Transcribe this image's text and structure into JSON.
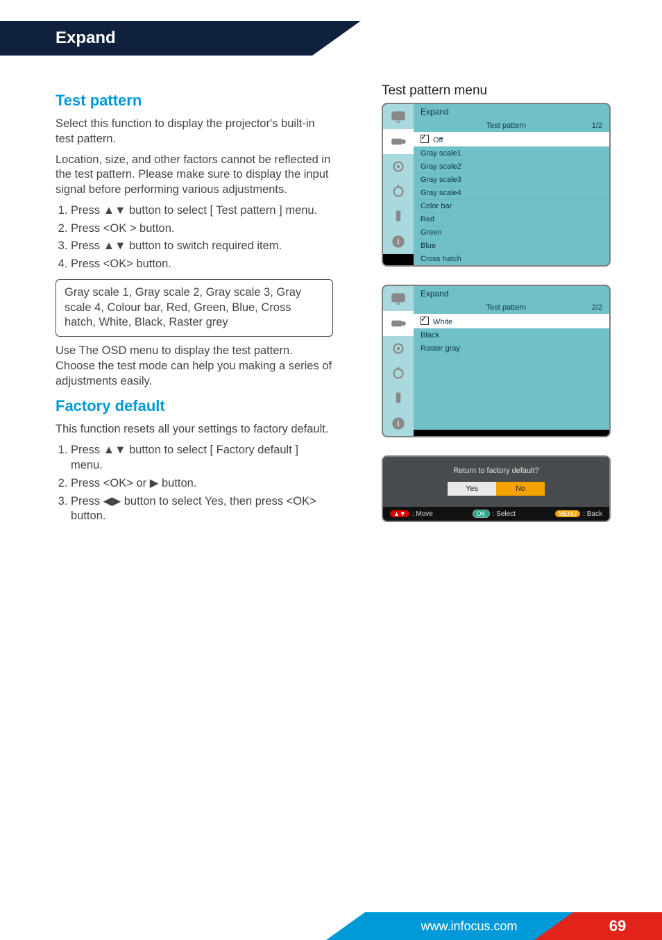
{
  "header": {
    "tab": "Expand"
  },
  "left": {
    "sec1_title": "Test pattern",
    "sec1_p1": "Select this function to display the projector's built-in test pattern.",
    "sec1_p2": "Location, size, and other factors cannot be reflected in the test pattern. Please make sure to display the input signal before performing various adjustments.",
    "sec1_steps": [
      "Press ▲▼ button to select [ Test pattern ] menu.",
      "Press <OK > button.",
      "Press ▲▼ button to switch required item.",
      "Press <OK> button."
    ],
    "sec1_box": "Gray scale 1, Gray scale 2, Gray scale 3, Gray scale 4, Colour bar, Red, Green, Blue, Cross hatch, White, Black, Raster grey",
    "sec1_p3": "Use The OSD menu to display the test pattern. Choose the test mode can help you making a series of adjustments easily.",
    "sec2_title": "Factory default",
    "sec2_p1": "This function resets all your settings to factory default.",
    "sec2_steps": [
      "Press ▲▼ button to select [ Factory default ] menu.",
      "Press <OK> or ▶ button.",
      "Press ◀▶ button to select Yes, then press <OK> button."
    ]
  },
  "right": {
    "title": "Test pattern menu",
    "osd1": {
      "header": "Expand",
      "sub": "Test pattern",
      "page": "1/2",
      "selected": "Off",
      "rows": [
        "Gray scale1",
        "Gray scale2",
        "Gray scale3",
        "Gray scale4",
        "Color bar",
        "Red",
        "Green",
        "Blue",
        "Cross hatch"
      ]
    },
    "osd2": {
      "header": "Expand",
      "sub": "Test pattern",
      "page": "2/2",
      "selected": "White",
      "rows": [
        "Black",
        "Raster gray"
      ]
    },
    "dialog": {
      "title": "Return to factory default?",
      "yes": "Yes",
      "no": "No",
      "foot_move": "Move",
      "foot_select": "Select",
      "foot_back": "Back",
      "foot_ok": "OK",
      "foot_menu": "MENU"
    }
  },
  "footer": {
    "url": "www.infocus.com",
    "page": "69"
  }
}
